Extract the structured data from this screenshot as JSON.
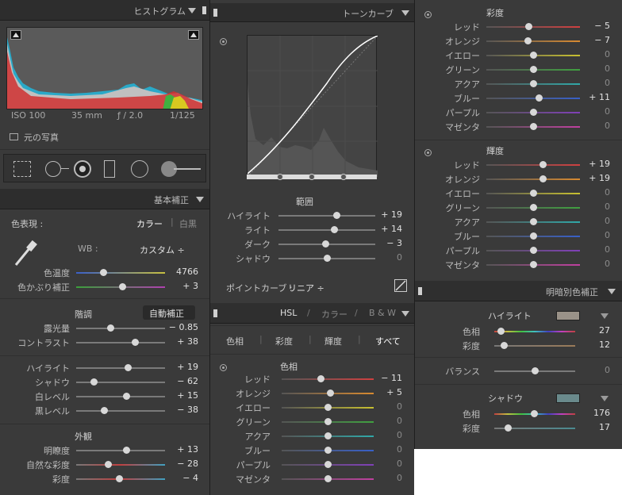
{
  "histogram": {
    "title": "ヒストグラム",
    "iso": "ISO 100",
    "focal": "35 mm",
    "aperture": "ƒ / 2.0",
    "shutter": "1/125",
    "original_photo": "元の写真"
  },
  "basic": {
    "title": "基本補正",
    "treatment_label": "色表現 :",
    "color": "カラー",
    "bw": "白黒",
    "wb_label": "WB :",
    "wb_value": "カスタム ÷",
    "temp": {
      "label": "色温度",
      "value": "4766",
      "pos": 0.3
    },
    "tint": {
      "label": "色かぶり補正",
      "value": "+ 3",
      "pos": 0.52
    },
    "tone_label": "階調",
    "auto": "自動補正",
    "exposure": {
      "label": "露光量",
      "value": "− 0.85",
      "pos": 0.38
    },
    "contrast": {
      "label": "コントラスト",
      "value": "+ 38",
      "pos": 0.66
    },
    "highlights": {
      "label": "ハイライト",
      "value": "+ 19",
      "pos": 0.58
    },
    "shadows": {
      "label": "シャドウ",
      "value": "− 62",
      "pos": 0.2
    },
    "whites": {
      "label": "白レベル",
      "value": "+ 15",
      "pos": 0.56
    },
    "blacks": {
      "label": "黒レベル",
      "value": "− 38",
      "pos": 0.31
    },
    "presence_label": "外観",
    "clarity": {
      "label": "明瞭度",
      "value": "+ 13",
      "pos": 0.56
    },
    "vibrance": {
      "label": "自然な彩度",
      "value": "− 28",
      "pos": 0.36
    },
    "saturation": {
      "label": "彩度",
      "value": "− 4",
      "pos": 0.48
    }
  },
  "tone_curve": {
    "title": "トーンカーブ",
    "region_label": "範囲",
    "highlights": {
      "label": "ハイライト",
      "value": "+ 19",
      "pos": 0.6
    },
    "lights": {
      "label": "ライト",
      "value": "+ 14",
      "pos": 0.57
    },
    "darks": {
      "label": "ダーク",
      "value": "− 3",
      "pos": 0.48
    },
    "shadows": {
      "label": "シャドウ",
      "value": "0",
      "pos": 0.5
    },
    "point_curve_label": "ポイントカーブ :",
    "point_curve_value": "リニア ÷"
  },
  "hsl": {
    "title_hsl": "HSL",
    "title_color": "カラー",
    "title_bw": "B & W",
    "tabs": [
      "色相",
      "彩度",
      "輝度",
      "すべて"
    ],
    "hue_label": "色相",
    "rows": [
      {
        "label": "レッド",
        "value": "− 11",
        "pos": 0.42,
        "color": "#d04040"
      },
      {
        "label": "オレンジ",
        "value": "+ 5",
        "pos": 0.53,
        "color": "#d88a30"
      },
      {
        "label": "イエロー",
        "value": "0",
        "pos": 0.5,
        "color": "#c8c030"
      },
      {
        "label": "グリーン",
        "value": "0",
        "pos": 0.5,
        "color": "#40a040"
      },
      {
        "label": "アクア",
        "value": "0",
        "pos": 0.5,
        "color": "#30a8a8"
      },
      {
        "label": "ブルー",
        "value": "0",
        "pos": 0.5,
        "color": "#3860c8"
      },
      {
        "label": "パープル",
        "value": "0",
        "pos": 0.5,
        "color": "#8040b8"
      },
      {
        "label": "マゼンタ",
        "value": "0",
        "pos": 0.5,
        "color": "#c040a0"
      }
    ]
  },
  "saturation_panel": {
    "title": "彩度",
    "rows": [
      {
        "label": "レッド",
        "value": "− 5",
        "pos": 0.45,
        "color": "#d04040"
      },
      {
        "label": "オレンジ",
        "value": "− 7",
        "pos": 0.44,
        "color": "#d88a30"
      },
      {
        "label": "イエロー",
        "value": "0",
        "pos": 0.5,
        "color": "#c8c030"
      },
      {
        "label": "グリーン",
        "value": "0",
        "pos": 0.5,
        "color": "#40a040"
      },
      {
        "label": "アクア",
        "value": "0",
        "pos": 0.5,
        "color": "#30a8a8"
      },
      {
        "label": "ブルー",
        "value": "+ 11",
        "pos": 0.56,
        "color": "#3860c8"
      },
      {
        "label": "パープル",
        "value": "0",
        "pos": 0.5,
        "color": "#8040b8"
      },
      {
        "label": "マゼンタ",
        "value": "0",
        "pos": 0.5,
        "color": "#c040a0"
      }
    ]
  },
  "luminance_panel": {
    "title": "輝度",
    "rows": [
      {
        "label": "レッド",
        "value": "+ 19",
        "pos": 0.6,
        "color": "#d04040"
      },
      {
        "label": "オレンジ",
        "value": "+ 19",
        "pos": 0.6,
        "color": "#d88a30"
      },
      {
        "label": "イエロー",
        "value": "0",
        "pos": 0.5,
        "color": "#c8c030"
      },
      {
        "label": "グリーン",
        "value": "0",
        "pos": 0.5,
        "color": "#40a040"
      },
      {
        "label": "アクア",
        "value": "0",
        "pos": 0.5,
        "color": "#30a8a8"
      },
      {
        "label": "ブルー",
        "value": "0",
        "pos": 0.5,
        "color": "#3860c8"
      },
      {
        "label": "パープル",
        "value": "0",
        "pos": 0.5,
        "color": "#8040b8"
      },
      {
        "label": "マゼンタ",
        "value": "0",
        "pos": 0.5,
        "color": "#c040a0"
      }
    ]
  },
  "split_toning": {
    "title": "明暗別色補正",
    "highlights_label": "ハイライト",
    "highlight_swatch": "#9a9288",
    "hl_hue": {
      "label": "色相",
      "value": "27",
      "pos": 0.08
    },
    "hl_sat": {
      "label": "彩度",
      "value": "12",
      "pos": 0.12
    },
    "balance": {
      "label": "バランス",
      "value": "0",
      "pos": 0.5
    },
    "shadows_label": "シャドウ",
    "shadow_swatch": "#6a8a8c",
    "sh_hue": {
      "label": "色相",
      "value": "176",
      "pos": 0.49
    },
    "sh_sat": {
      "label": "彩度",
      "value": "17",
      "pos": 0.17
    }
  }
}
